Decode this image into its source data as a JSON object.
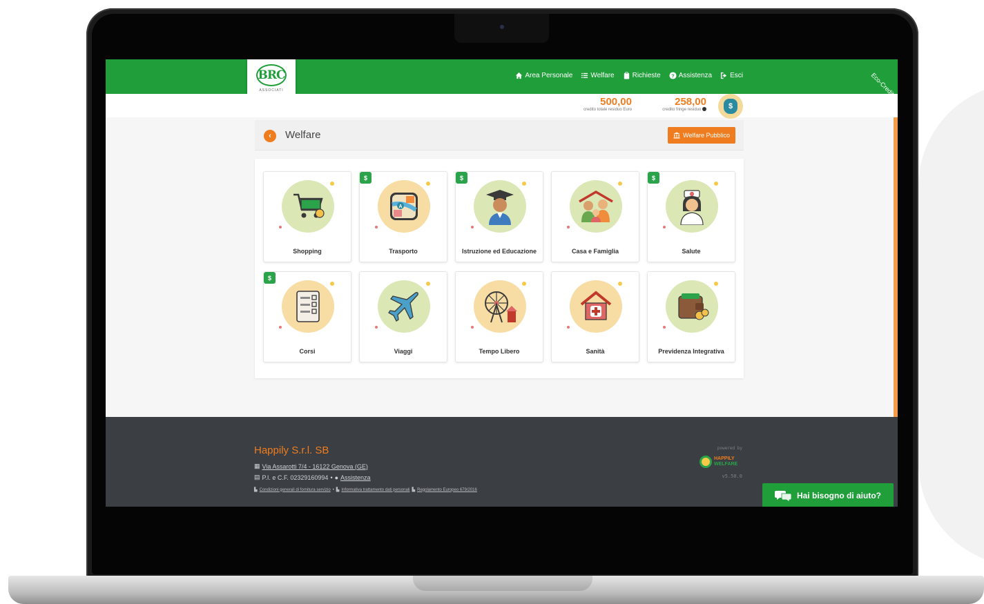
{
  "header": {
    "logo_text": "BRC",
    "logo_sub": "ASSOCIATI",
    "nav": [
      {
        "label": "Area Personale",
        "icon": "home-icon"
      },
      {
        "label": "Welfare",
        "icon": "list-icon"
      },
      {
        "label": "Richieste",
        "icon": "clipboard-icon"
      },
      {
        "label": "Assistenza",
        "icon": "question-icon"
      },
      {
        "label": "Esci",
        "icon": "logout-icon"
      }
    ],
    "ribbon": "Eco-Credito"
  },
  "credits": {
    "total_amount": "500,00",
    "total_label": "credito totale residuo Euro",
    "fringe_amount": "258,00",
    "fringe_label": "credito fringe residuo",
    "bag_symbol": "$"
  },
  "panel": {
    "title": "Welfare",
    "back_symbol": "‹",
    "public_button": "Welfare Pubblico"
  },
  "categories": [
    {
      "label": "Shopping",
      "icon": "shopping-cart-icon",
      "badge": false
    },
    {
      "label": "Trasporto",
      "icon": "map-icon",
      "badge": true
    },
    {
      "label": "Istruzione ed Educazione",
      "icon": "graduate-icon",
      "badge": true
    },
    {
      "label": "Casa e Famiglia",
      "icon": "family-icon",
      "badge": false
    },
    {
      "label": "Salute",
      "icon": "nurse-icon",
      "badge": true
    },
    {
      "label": "Corsi",
      "icon": "checklist-icon",
      "badge": true
    },
    {
      "label": "Viaggi",
      "icon": "airplane-icon",
      "badge": false
    },
    {
      "label": "Tempo Libero",
      "icon": "ferris-wheel-icon",
      "badge": false
    },
    {
      "label": "Sanità",
      "icon": "hospital-icon",
      "badge": false
    },
    {
      "label": "Previdenza Integrativa",
      "icon": "wallet-icon",
      "badge": false
    }
  ],
  "footer": {
    "company": "Happily S.r.l. SB",
    "address": "Via Assarotti 7/4 - 16122 Genova (GE)",
    "vat": "P.I. e C.F. 02329160994",
    "assist": "Assistenza",
    "bullet": "•",
    "links": [
      "Condizioni generali di fornitura servizio",
      "Informativa trattamento dati personali",
      "Regolamento Europeo 679/2016"
    ],
    "powered_by": "powered by",
    "brand_top": "HAPPILY",
    "brand_bottom": "WELFARE",
    "version": "v5.50.0"
  },
  "help": {
    "label": "Hai bisogno di aiuto?"
  },
  "colors": {
    "brand_green": "#1f9e3a",
    "accent_orange": "#ef7d1f",
    "footer_bg": "#3b3e42"
  }
}
